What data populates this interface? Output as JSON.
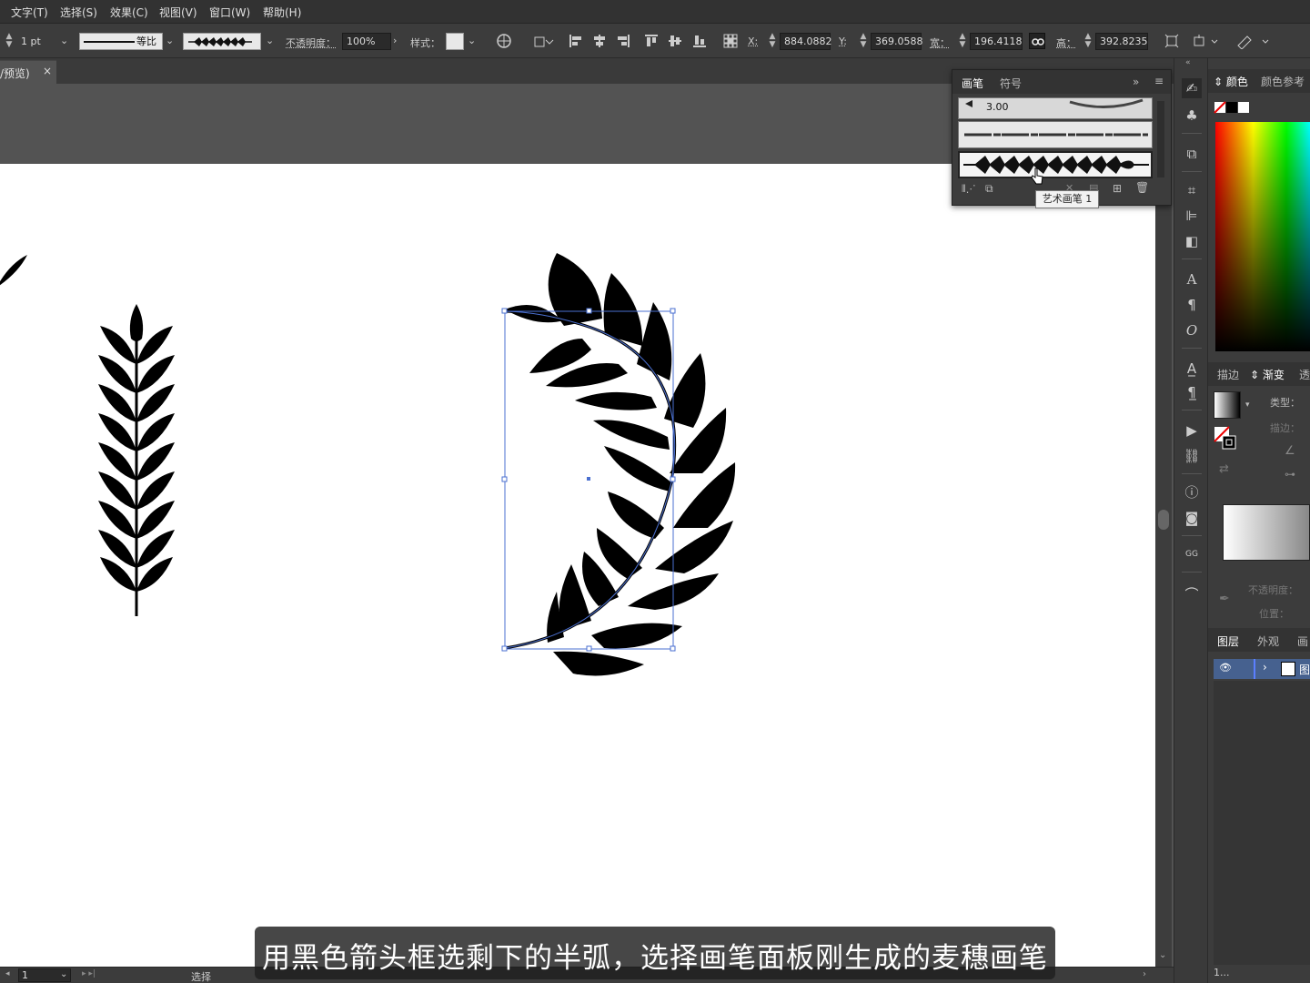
{
  "menu": [
    "文字(T)",
    "选择(S)",
    "效果(C)",
    "视图(V)",
    "窗口(W)",
    "帮助(H)"
  ],
  "controlbar": {
    "stroke_weight": "1 pt",
    "profile_label": "等比",
    "opacity_label": "不透明度：",
    "opacity_value": "100%",
    "style_label": "样式：",
    "x_label": "X:",
    "x_value": "884.0882",
    "y_label": "Y:",
    "y_value": "369.0588",
    "w_label": "宽：",
    "w_value": "196.4118",
    "h_label": "高：",
    "h_value": "392.8235"
  },
  "doc_tab": {
    "title": "/预览)",
    "close": "×"
  },
  "brush_panel": {
    "tabs": [
      "画笔",
      "符号"
    ],
    "size_label": "3.00",
    "tooltip": "艺术画笔 1"
  },
  "right_panels": {
    "color_tabs": [
      "颜色",
      "颜色参考"
    ],
    "gradient_tabs": [
      "描边",
      "渐变",
      "透"
    ],
    "gradient_type_label": "类型：",
    "gradient_stroke_label": "描边：",
    "gradient_opacity_label": "不透明度：",
    "gradient_position_label": "位置：",
    "layer_tabs": [
      "图层",
      "外观",
      "画"
    ],
    "layer_name": "图",
    "layer_count": "1..."
  },
  "statusbar": {
    "zoom": "1",
    "tool": "选择"
  },
  "subtitle": "用黑色箭头框选剩下的半弧，选择画笔面板刚生成的麦穗画笔"
}
